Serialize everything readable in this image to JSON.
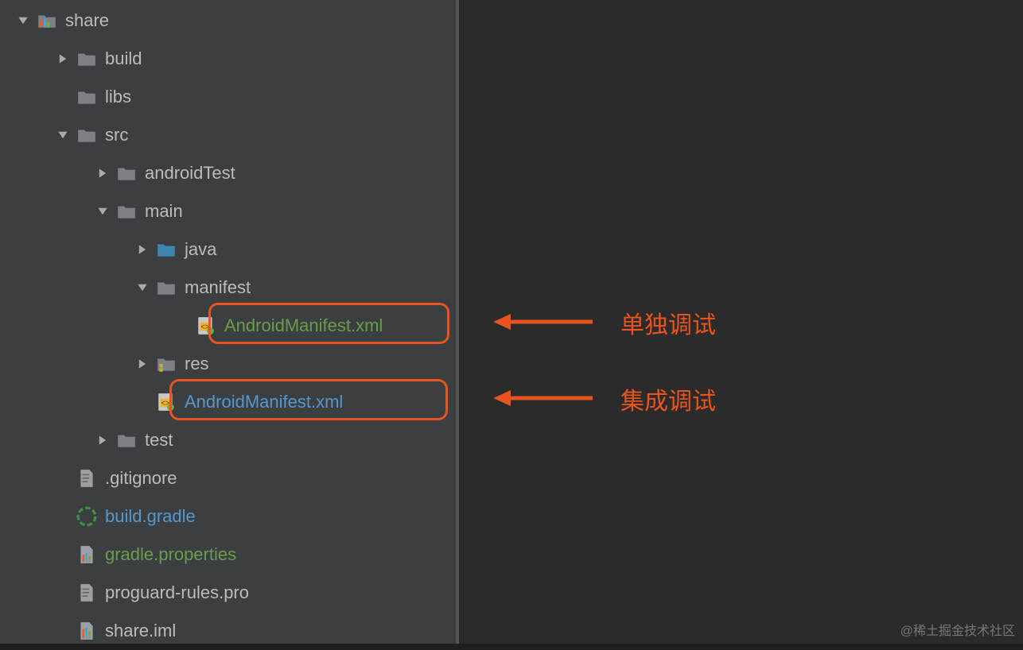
{
  "tree": {
    "share": "share",
    "build": "build",
    "libs": "libs",
    "src": "src",
    "androidTest": "androidTest",
    "main": "main",
    "java": "java",
    "manifest": "manifest",
    "manifest_xml": "AndroidManifest.xml",
    "res": "res",
    "main_xml": "AndroidManifest.xml",
    "test": "test",
    "gitignore": ".gitignore",
    "build_gradle": "build.gradle",
    "gradle_props": "gradle.properties",
    "proguard": "proguard-rules.pro",
    "share_iml": "share.iml"
  },
  "annotations": {
    "standalone_debug": "单独调试",
    "integration_debug": "集成调试"
  },
  "watermark": "@稀土掘金技术社区",
  "colors": {
    "highlight": "#e8531f",
    "folder_grey": "#7d8185",
    "folder_blue": "#3e86b0",
    "text_green": "#6a9b4d",
    "text_blue": "#5896c9"
  }
}
